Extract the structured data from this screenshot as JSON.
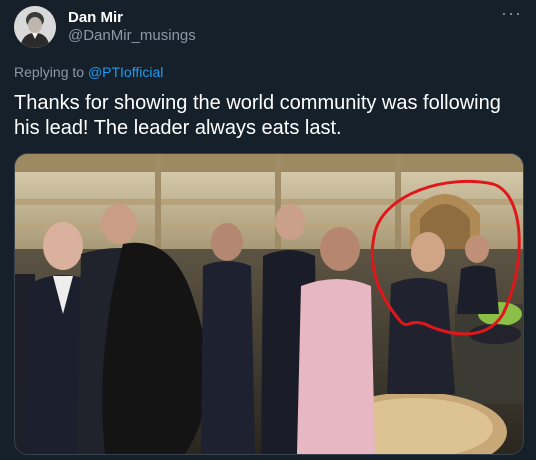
{
  "author": {
    "display_name": "Dan Mir",
    "handle": "@DanMir_musings",
    "avatar_icon": "profile-portrait"
  },
  "more_icon": "ellipsis-icon",
  "more_glyph": "···",
  "reply": {
    "prefix": "Replying to ",
    "mention": "@PTIofficial"
  },
  "tweet": {
    "text": "Thanks for showing the world community was following his lead! The leader always eats last."
  },
  "media": {
    "description_icon": "photo",
    "highlight_color": "#e0161b"
  },
  "colors": {
    "background": "#15202b",
    "secondary_text": "#8b98a5",
    "link": "#1d9bf0"
  }
}
